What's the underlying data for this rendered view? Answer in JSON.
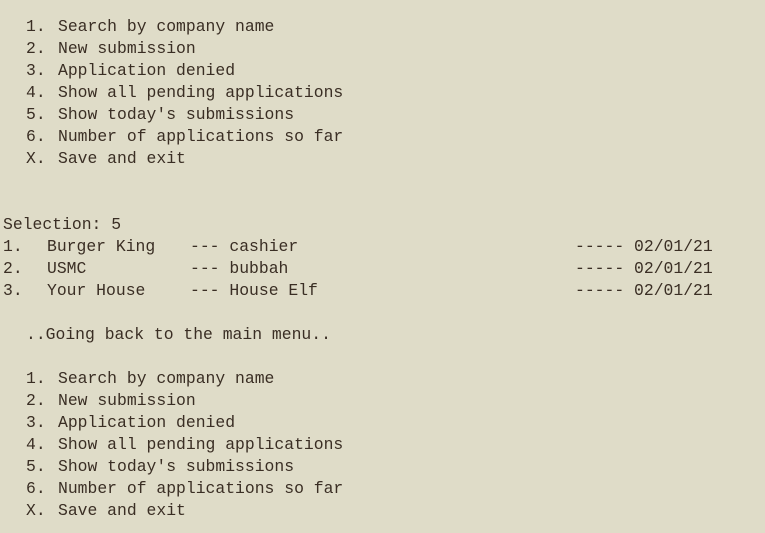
{
  "colors": {
    "background": "#dfdcc8",
    "text": "#3a2e24"
  },
  "menu_top": {
    "items": [
      {
        "num": "1.",
        "label": "Search by company name"
      },
      {
        "num": "2.",
        "label": "New submission"
      },
      {
        "num": "3.",
        "label": "Application denied"
      },
      {
        "num": "4.",
        "label": "Show all pending applications"
      },
      {
        "num": "5.",
        "label": "Show today's submissions"
      },
      {
        "num": "6.",
        "label": "Number of applications so far"
      },
      {
        "num": "X.",
        "label": "Save and exit"
      }
    ]
  },
  "prompt": {
    "label": "Selection: ",
    "value": "5"
  },
  "results": [
    {
      "num": "1.",
      "company": "Burger King",
      "sep": "---",
      "job": "cashier",
      "date": "----- 02/01/21"
    },
    {
      "num": "2.",
      "company": "USMC",
      "sep": "---",
      "job": "bubbah",
      "date": "----- 02/01/21"
    },
    {
      "num": "3.",
      "company": "Your House",
      "sep": "---",
      "job": "House Elf",
      "date": "----- 02/01/21"
    }
  ],
  "status_message": "..Going back to the main menu..",
  "menu_bottom": {
    "items": [
      {
        "num": "1.",
        "label": "Search by company name"
      },
      {
        "num": "2.",
        "label": "New submission"
      },
      {
        "num": "3.",
        "label": "Application denied"
      },
      {
        "num": "4.",
        "label": "Show all pending applications"
      },
      {
        "num": "5.",
        "label": "Show today's submissions"
      },
      {
        "num": "6.",
        "label": "Number of applications so far"
      },
      {
        "num": "X.",
        "label": "Save and exit"
      }
    ]
  }
}
